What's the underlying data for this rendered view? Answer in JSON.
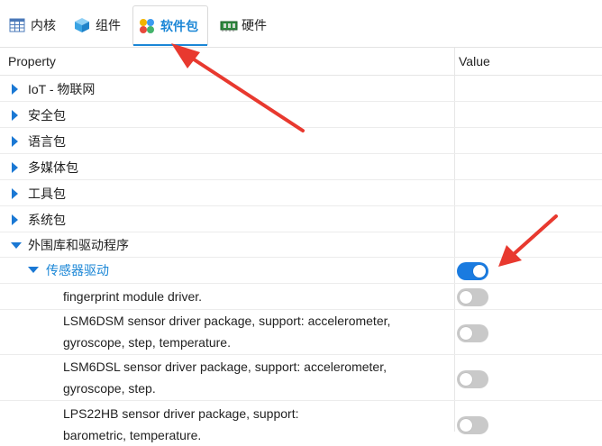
{
  "tabs": [
    {
      "label": "内核",
      "icon": "table-icon"
    },
    {
      "label": "组件",
      "icon": "cube-icon"
    },
    {
      "label": "软件包",
      "icon": "packages-icon",
      "active": true
    },
    {
      "label": "硬件",
      "icon": "board-icon"
    }
  ],
  "grid": {
    "header": {
      "property": "Property",
      "value": "Value"
    },
    "categories": [
      {
        "label": "IoT - 物联网"
      },
      {
        "label": "安全包"
      },
      {
        "label": "语言包"
      },
      {
        "label": "多媒体包"
      },
      {
        "label": "工具包"
      },
      {
        "label": "系统包"
      },
      {
        "label": "外围库和驱动程序",
        "expanded": true
      }
    ],
    "subcategory": {
      "label": "传感器驱动",
      "enabled": true
    },
    "items": [
      {
        "line1": "fingerprint module driver.",
        "line2": "",
        "enabled": false
      },
      {
        "line1": "LSM6DSM sensor driver package, support: accelerometer,",
        "line2": "gyroscope, step, temperature.",
        "enabled": false
      },
      {
        "line1": "LSM6DSL sensor driver package, support: accelerometer,",
        "line2": "gyroscope, step.",
        "enabled": false
      },
      {
        "line1": "LPS22HB sensor driver package, support:",
        "line2": "barometric, temperature.",
        "enabled": false
      }
    ]
  },
  "colors": {
    "accent": "#1a86d6",
    "annotation_arrow": "#e8392f",
    "toggle_on": "#1a7be0",
    "toggle_off": "#c9c9c9"
  }
}
